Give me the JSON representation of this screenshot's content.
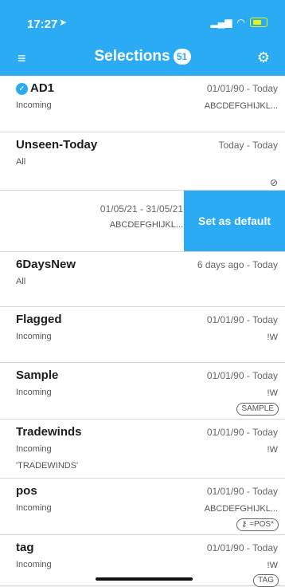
{
  "status_bar": {
    "time": "17:27",
    "location_arrow": "➤",
    "signal": "▂▄▆",
    "wifi": "wifi"
  },
  "header": {
    "title": "Selections",
    "count": "51",
    "menu_glyph": "≡",
    "settings_glyph": "⚙"
  },
  "rows": [
    {
      "name": "AD1",
      "dates": "01/01/90 - Today",
      "source": "Incoming",
      "filter": "ABCDEFGHIJKL...",
      "selected": true
    },
    {
      "name": "Unseen-Today",
      "dates": "Today - Today",
      "source": "All",
      "filter": "",
      "icon": "eye-slash-icon",
      "icon_glyph": "⊘"
    },
    {
      "dates": "01/05/21 - 31/05/21",
      "filter": "ABCDEFGHIJKL...",
      "action": "Set as default"
    },
    {
      "name": "6DaysNew",
      "dates": "6 days ago - Today",
      "source": "All",
      "filter": ""
    },
    {
      "name": "Flagged",
      "dates": "01/01/90 - Today",
      "source": "Incoming",
      "filter": "!W"
    },
    {
      "name": "Sample",
      "dates": "01/01/90 - Today",
      "source": "Incoming",
      "filter": "!W",
      "tag": "SAMPLE"
    },
    {
      "name": "Tradewinds",
      "dates": "01/01/90 - Today",
      "source": "Incoming",
      "source2": "'TRADEWINDS'",
      "filter": "!W"
    },
    {
      "name": "pos",
      "dates": "01/01/90 - Today",
      "source": "Incoming",
      "filter": "ABCDEFGHIJKL...",
      "tag": "=POS*",
      "tag_icon": "key-icon"
    },
    {
      "name": "tag",
      "dates": "01/01/90 - Today",
      "source": "Incoming",
      "filter": "!W",
      "tag": "TAG"
    }
  ],
  "colors": {
    "accent": "#2aabf3",
    "battery": "#e6f50f"
  }
}
